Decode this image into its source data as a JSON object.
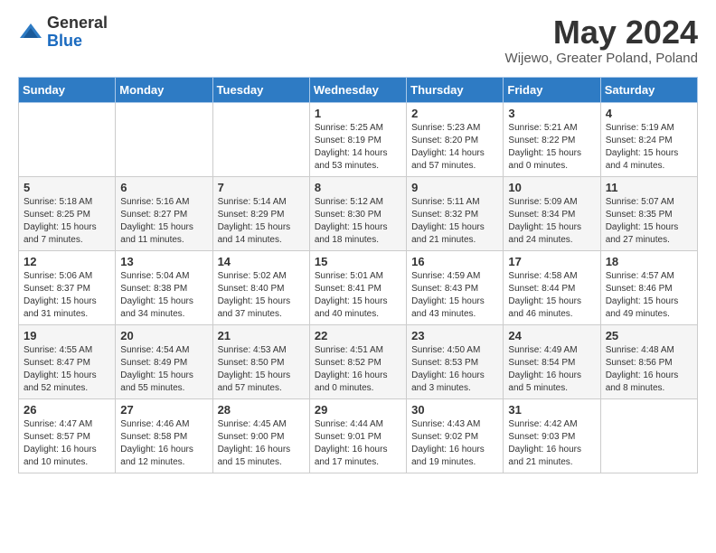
{
  "header": {
    "logo_general": "General",
    "logo_blue": "Blue",
    "month_title": "May 2024",
    "location": "Wijewo, Greater Poland, Poland"
  },
  "days_of_week": [
    "Sunday",
    "Monday",
    "Tuesday",
    "Wednesday",
    "Thursday",
    "Friday",
    "Saturday"
  ],
  "weeks": [
    [
      {
        "day": "",
        "info": ""
      },
      {
        "day": "",
        "info": ""
      },
      {
        "day": "",
        "info": ""
      },
      {
        "day": "1",
        "info": "Sunrise: 5:25 AM\nSunset: 8:19 PM\nDaylight: 14 hours\nand 53 minutes."
      },
      {
        "day": "2",
        "info": "Sunrise: 5:23 AM\nSunset: 8:20 PM\nDaylight: 14 hours\nand 57 minutes."
      },
      {
        "day": "3",
        "info": "Sunrise: 5:21 AM\nSunset: 8:22 PM\nDaylight: 15 hours\nand 0 minutes."
      },
      {
        "day": "4",
        "info": "Sunrise: 5:19 AM\nSunset: 8:24 PM\nDaylight: 15 hours\nand 4 minutes."
      }
    ],
    [
      {
        "day": "5",
        "info": "Sunrise: 5:18 AM\nSunset: 8:25 PM\nDaylight: 15 hours\nand 7 minutes."
      },
      {
        "day": "6",
        "info": "Sunrise: 5:16 AM\nSunset: 8:27 PM\nDaylight: 15 hours\nand 11 minutes."
      },
      {
        "day": "7",
        "info": "Sunrise: 5:14 AM\nSunset: 8:29 PM\nDaylight: 15 hours\nand 14 minutes."
      },
      {
        "day": "8",
        "info": "Sunrise: 5:12 AM\nSunset: 8:30 PM\nDaylight: 15 hours\nand 18 minutes."
      },
      {
        "day": "9",
        "info": "Sunrise: 5:11 AM\nSunset: 8:32 PM\nDaylight: 15 hours\nand 21 minutes."
      },
      {
        "day": "10",
        "info": "Sunrise: 5:09 AM\nSunset: 8:34 PM\nDaylight: 15 hours\nand 24 minutes."
      },
      {
        "day": "11",
        "info": "Sunrise: 5:07 AM\nSunset: 8:35 PM\nDaylight: 15 hours\nand 27 minutes."
      }
    ],
    [
      {
        "day": "12",
        "info": "Sunrise: 5:06 AM\nSunset: 8:37 PM\nDaylight: 15 hours\nand 31 minutes."
      },
      {
        "day": "13",
        "info": "Sunrise: 5:04 AM\nSunset: 8:38 PM\nDaylight: 15 hours\nand 34 minutes."
      },
      {
        "day": "14",
        "info": "Sunrise: 5:02 AM\nSunset: 8:40 PM\nDaylight: 15 hours\nand 37 minutes."
      },
      {
        "day": "15",
        "info": "Sunrise: 5:01 AM\nSunset: 8:41 PM\nDaylight: 15 hours\nand 40 minutes."
      },
      {
        "day": "16",
        "info": "Sunrise: 4:59 AM\nSunset: 8:43 PM\nDaylight: 15 hours\nand 43 minutes."
      },
      {
        "day": "17",
        "info": "Sunrise: 4:58 AM\nSunset: 8:44 PM\nDaylight: 15 hours\nand 46 minutes."
      },
      {
        "day": "18",
        "info": "Sunrise: 4:57 AM\nSunset: 8:46 PM\nDaylight: 15 hours\nand 49 minutes."
      }
    ],
    [
      {
        "day": "19",
        "info": "Sunrise: 4:55 AM\nSunset: 8:47 PM\nDaylight: 15 hours\nand 52 minutes."
      },
      {
        "day": "20",
        "info": "Sunrise: 4:54 AM\nSunset: 8:49 PM\nDaylight: 15 hours\nand 55 minutes."
      },
      {
        "day": "21",
        "info": "Sunrise: 4:53 AM\nSunset: 8:50 PM\nDaylight: 15 hours\nand 57 minutes."
      },
      {
        "day": "22",
        "info": "Sunrise: 4:51 AM\nSunset: 8:52 PM\nDaylight: 16 hours\nand 0 minutes."
      },
      {
        "day": "23",
        "info": "Sunrise: 4:50 AM\nSunset: 8:53 PM\nDaylight: 16 hours\nand 3 minutes."
      },
      {
        "day": "24",
        "info": "Sunrise: 4:49 AM\nSunset: 8:54 PM\nDaylight: 16 hours\nand 5 minutes."
      },
      {
        "day": "25",
        "info": "Sunrise: 4:48 AM\nSunset: 8:56 PM\nDaylight: 16 hours\nand 8 minutes."
      }
    ],
    [
      {
        "day": "26",
        "info": "Sunrise: 4:47 AM\nSunset: 8:57 PM\nDaylight: 16 hours\nand 10 minutes."
      },
      {
        "day": "27",
        "info": "Sunrise: 4:46 AM\nSunset: 8:58 PM\nDaylight: 16 hours\nand 12 minutes."
      },
      {
        "day": "28",
        "info": "Sunrise: 4:45 AM\nSunset: 9:00 PM\nDaylight: 16 hours\nand 15 minutes."
      },
      {
        "day": "29",
        "info": "Sunrise: 4:44 AM\nSunset: 9:01 PM\nDaylight: 16 hours\nand 17 minutes."
      },
      {
        "day": "30",
        "info": "Sunrise: 4:43 AM\nSunset: 9:02 PM\nDaylight: 16 hours\nand 19 minutes."
      },
      {
        "day": "31",
        "info": "Sunrise: 4:42 AM\nSunset: 9:03 PM\nDaylight: 16 hours\nand 21 minutes."
      },
      {
        "day": "",
        "info": ""
      }
    ]
  ]
}
